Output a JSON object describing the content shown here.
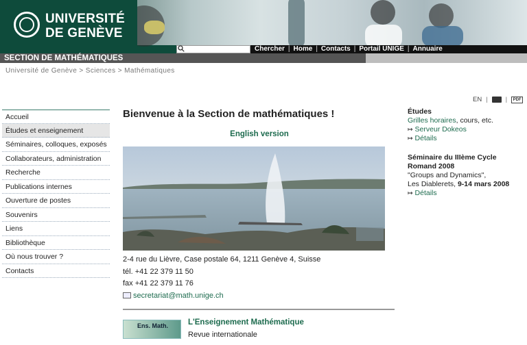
{
  "header": {
    "university_name_line1": "UNIVERSITÉ",
    "university_name_line2": "DE GENÈVE",
    "section": "SECTION DE MATHÉMATIQUES"
  },
  "topnav": {
    "items": [
      "Chercher",
      "Home",
      "Contacts",
      "Portail UNIGE",
      "Annuaire"
    ]
  },
  "breadcrumb": "Université de Genève > Sciences > Mathématiques",
  "tools": {
    "language": "EN",
    "print_icon": "printer-icon",
    "pdf_label": "PDF"
  },
  "leftnav": {
    "items": [
      "Accueil",
      "Études et enseignement",
      "Séminaires, colloques, exposés",
      "Collaborateurs, administration",
      "Recherche",
      "Publications internes",
      "Ouverture de postes",
      "Souvenirs",
      "Liens",
      "Bibliothèque",
      "Où nous trouver ?",
      "Contacts"
    ],
    "active_index": 1
  },
  "main": {
    "title": "Bienvenue à la Section de mathématiques !",
    "english_link": "English version",
    "address": "2-4 rue du Lièvre, Case postale 64, 1211 Genève 4, Suisse",
    "tel": "tél. +41 22 379 11 50",
    "fax": "fax +41 22 379 11 76",
    "email": "secretariat@math.unige.ch",
    "ens_logo": "Ens. Math.",
    "ens_title": "L'Enseignement Mathématique",
    "ens_subtitle": "Revue internationale"
  },
  "right": {
    "etudes_heading": "Études",
    "etudes_link": "Grilles horaires",
    "etudes_suffix": ", cours, etc.",
    "serveur_link": "Serveur Dokeos",
    "details1": "Détails",
    "seminaire_heading": "Séminaire du IIIème Cycle Romand 2008",
    "seminaire_text1": "\"Groups and Dynamics\",",
    "seminaire_text2_plain": "Les Diablerets, ",
    "seminaire_text2_bold": "9-14 mars 2008",
    "details2": "Détails"
  }
}
